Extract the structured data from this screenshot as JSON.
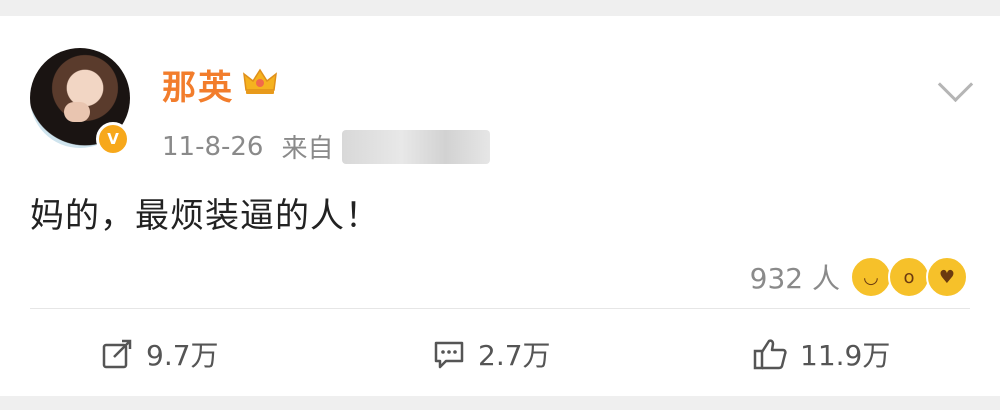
{
  "post": {
    "username": "那英",
    "timestamp": "11-8-26",
    "source_prefix": "来自",
    "text": "妈的，最烦装逼的人！",
    "reactions": {
      "count_label": "932 人",
      "emoji_icons": [
        "grinning-face-icon",
        "astonished-face-icon",
        "kissing-face-icon"
      ]
    }
  },
  "actions": {
    "repost_count": "9.7万",
    "comment_count": "2.7万",
    "like_count": "11.9万"
  },
  "colors": {
    "username": "#f27d2c",
    "verified_badge": "#f7a81b",
    "meta_text": "#8a8a8a"
  }
}
